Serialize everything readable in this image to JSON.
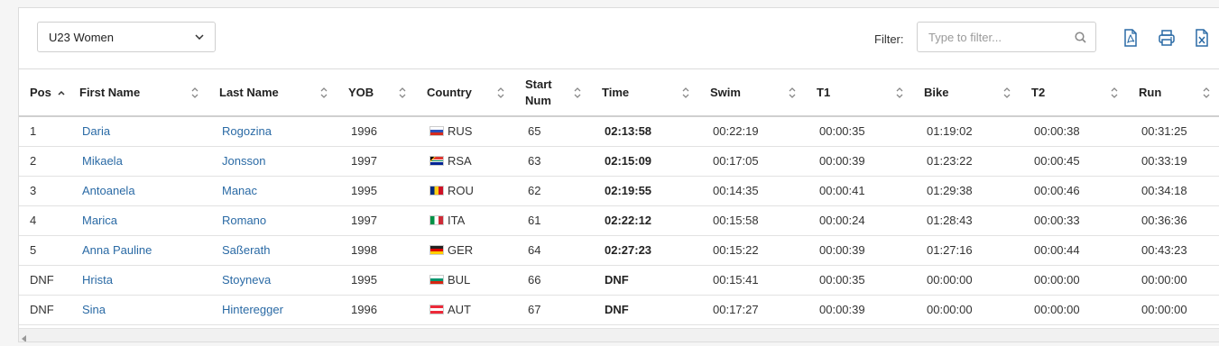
{
  "category_select": {
    "value": "U23 Women"
  },
  "filter": {
    "label": "Filter:",
    "placeholder": "Type to filter..."
  },
  "toolbar_icons": [
    "pdf-icon",
    "print-icon",
    "excel-icon"
  ],
  "columns": [
    "Pos",
    "First Name",
    "Last Name",
    "YOB",
    "Country",
    "Start Num",
    "Time",
    "Swim",
    "T1",
    "Bike",
    "T2",
    "Run"
  ],
  "sorted_column": "Pos",
  "rows": [
    {
      "pos": "1",
      "first": "Daria",
      "last": "Rogozina",
      "yob": "1996",
      "country": "RUS",
      "start": "65",
      "time": "02:13:58",
      "swim": "00:22:19",
      "t1": "00:00:35",
      "bike": "01:19:02",
      "t2": "00:00:38",
      "run": "00:31:25"
    },
    {
      "pos": "2",
      "first": "Mikaela",
      "last": "Jonsson",
      "yob": "1997",
      "country": "RSA",
      "start": "63",
      "time": "02:15:09",
      "swim": "00:17:05",
      "t1": "00:00:39",
      "bike": "01:23:22",
      "t2": "00:00:45",
      "run": "00:33:19"
    },
    {
      "pos": "3",
      "first": "Antoanela",
      "last": "Manac",
      "yob": "1995",
      "country": "ROU",
      "start": "62",
      "time": "02:19:55",
      "swim": "00:14:35",
      "t1": "00:00:41",
      "bike": "01:29:38",
      "t2": "00:00:46",
      "run": "00:34:18"
    },
    {
      "pos": "4",
      "first": "Marica",
      "last": "Romano",
      "yob": "1997",
      "country": "ITA",
      "start": "61",
      "time": "02:22:12",
      "swim": "00:15:58",
      "t1": "00:00:24",
      "bike": "01:28:43",
      "t2": "00:00:33",
      "run": "00:36:36"
    },
    {
      "pos": "5",
      "first": "Anna Pauline",
      "last": "Saßerath",
      "yob": "1998",
      "country": "GER",
      "start": "64",
      "time": "02:27:23",
      "swim": "00:15:22",
      "t1": "00:00:39",
      "bike": "01:27:16",
      "t2": "00:00:44",
      "run": "00:43:23"
    },
    {
      "pos": "DNF",
      "first": "Hrista",
      "last": "Stoyneva",
      "yob": "1995",
      "country": "BUL",
      "start": "66",
      "time": "DNF",
      "swim": "00:15:41",
      "t1": "00:00:35",
      "bike": "00:00:00",
      "t2": "00:00:00",
      "run": "00:00:00"
    },
    {
      "pos": "DNF",
      "first": "Sina",
      "last": "Hinteregger",
      "yob": "1996",
      "country": "AUT",
      "start": "67",
      "time": "DNF",
      "swim": "00:17:27",
      "t1": "00:00:39",
      "bike": "00:00:00",
      "t2": "00:00:00",
      "run": "00:00:00"
    }
  ],
  "colors": {
    "link": "#2a6aa5",
    "icon": "#2a6aa5",
    "border": "#dcdcdc"
  }
}
